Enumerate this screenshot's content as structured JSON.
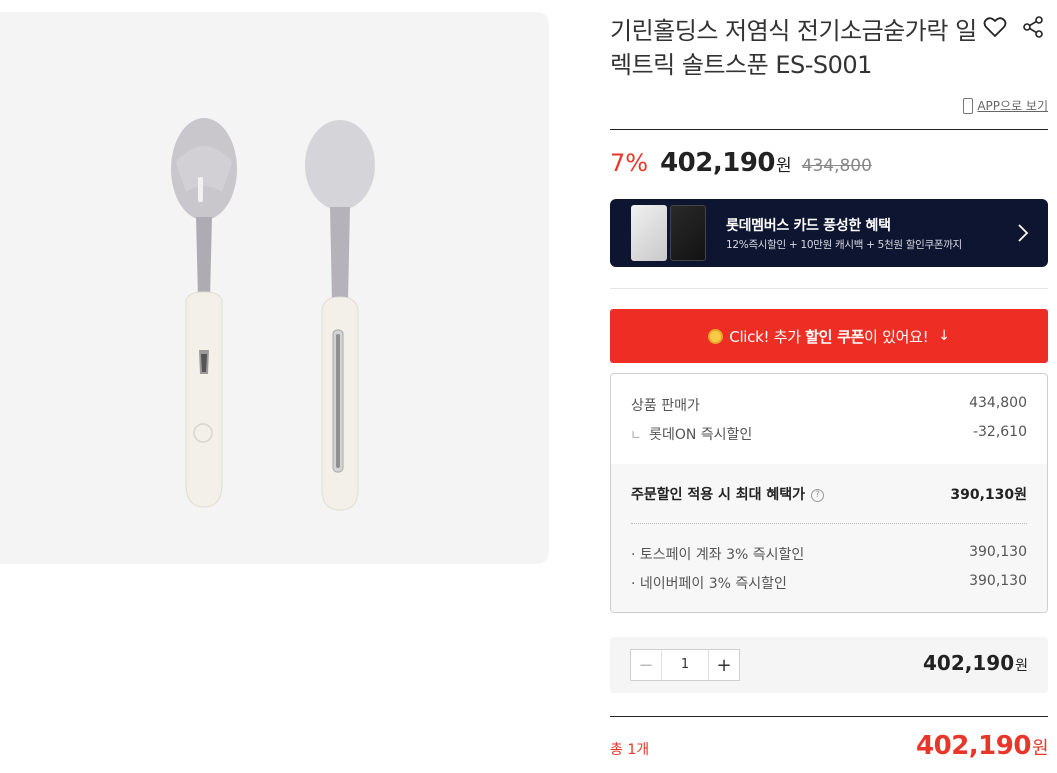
{
  "product": {
    "title": "기린홀딩스 저염식 전기소금숟가락 일렉트릭 솔트스푼 ES-S001",
    "image_alt": "electric salt spoon product image"
  },
  "header_actions": {
    "wishlist_icon": "heart-icon",
    "share_icon": "share-icon",
    "app_link_label": "APP으로 보기"
  },
  "price": {
    "discount_rate": "7%",
    "sale_price": "402,190",
    "currency": "원",
    "original_price": "434,800"
  },
  "card_banner": {
    "title": "롯데멤버스 카드 풍성한 혜택",
    "subtitle": "12%즉시할인 + 10만원 캐시백 + 5천원 할인쿠폰까지"
  },
  "coupon_button": {
    "prefix": "Click! 추가 ",
    "highlight": "할인 쿠폰",
    "suffix": "이 있어요!",
    "arrow": "↓"
  },
  "price_breakdown": {
    "list_price_label": "상품 판매가",
    "list_price_value": "434,800",
    "instant_discount_label": "롯데ON 즉시할인",
    "instant_discount_value": "-32,610",
    "best_price_label": "주문할인 적용 시 최대 혜택가",
    "best_price_value": "390,130원",
    "benefits": [
      {
        "label": "· 토스페이 계좌 3% 즉시할인",
        "value": "390,130"
      },
      {
        "label": "· 네이버페이 3% 즉시할인",
        "value": "390,130"
      }
    ]
  },
  "quantity": {
    "value": "1",
    "minus": "−",
    "plus": "+",
    "line_price": "402,190",
    "currency": "원"
  },
  "total": {
    "label": "총 1개",
    "price": "402,190",
    "currency": "원"
  },
  "colors": {
    "accent_red": "#ee2e24",
    "banner_navy": "#0d1530"
  }
}
